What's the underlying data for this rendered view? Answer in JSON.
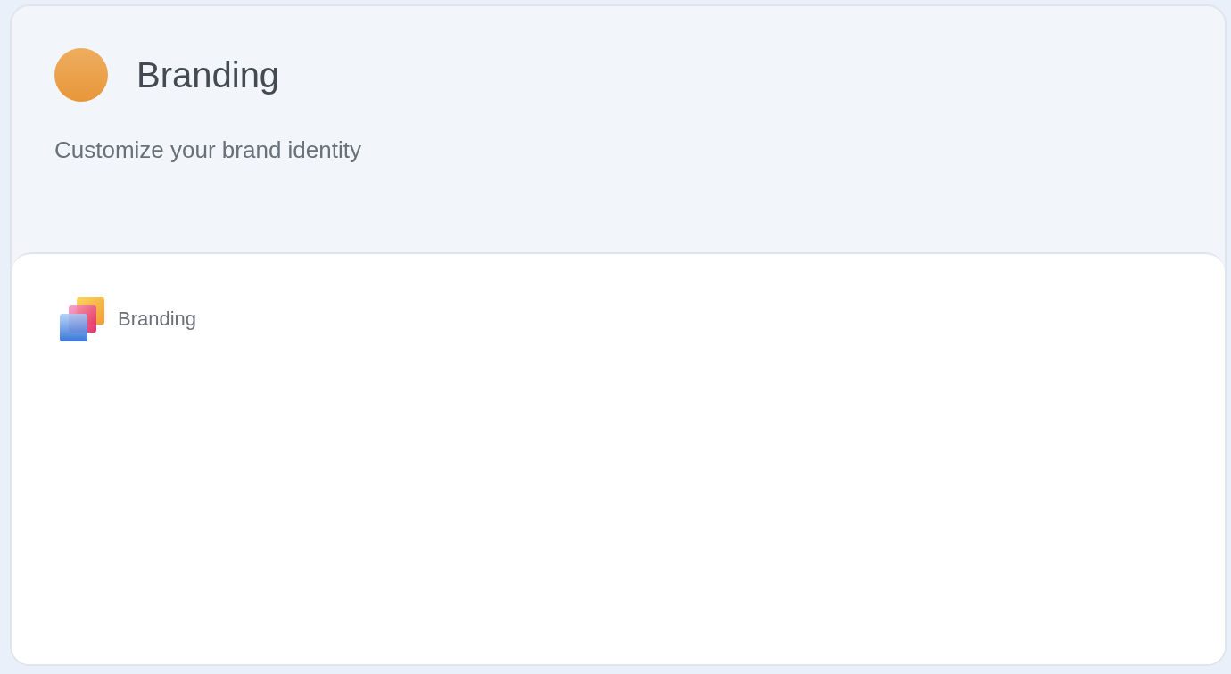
{
  "header": {
    "title": "Branding",
    "subtitle": "Customize your brand identity"
  },
  "items": [
    {
      "label": "Branding"
    }
  ]
}
